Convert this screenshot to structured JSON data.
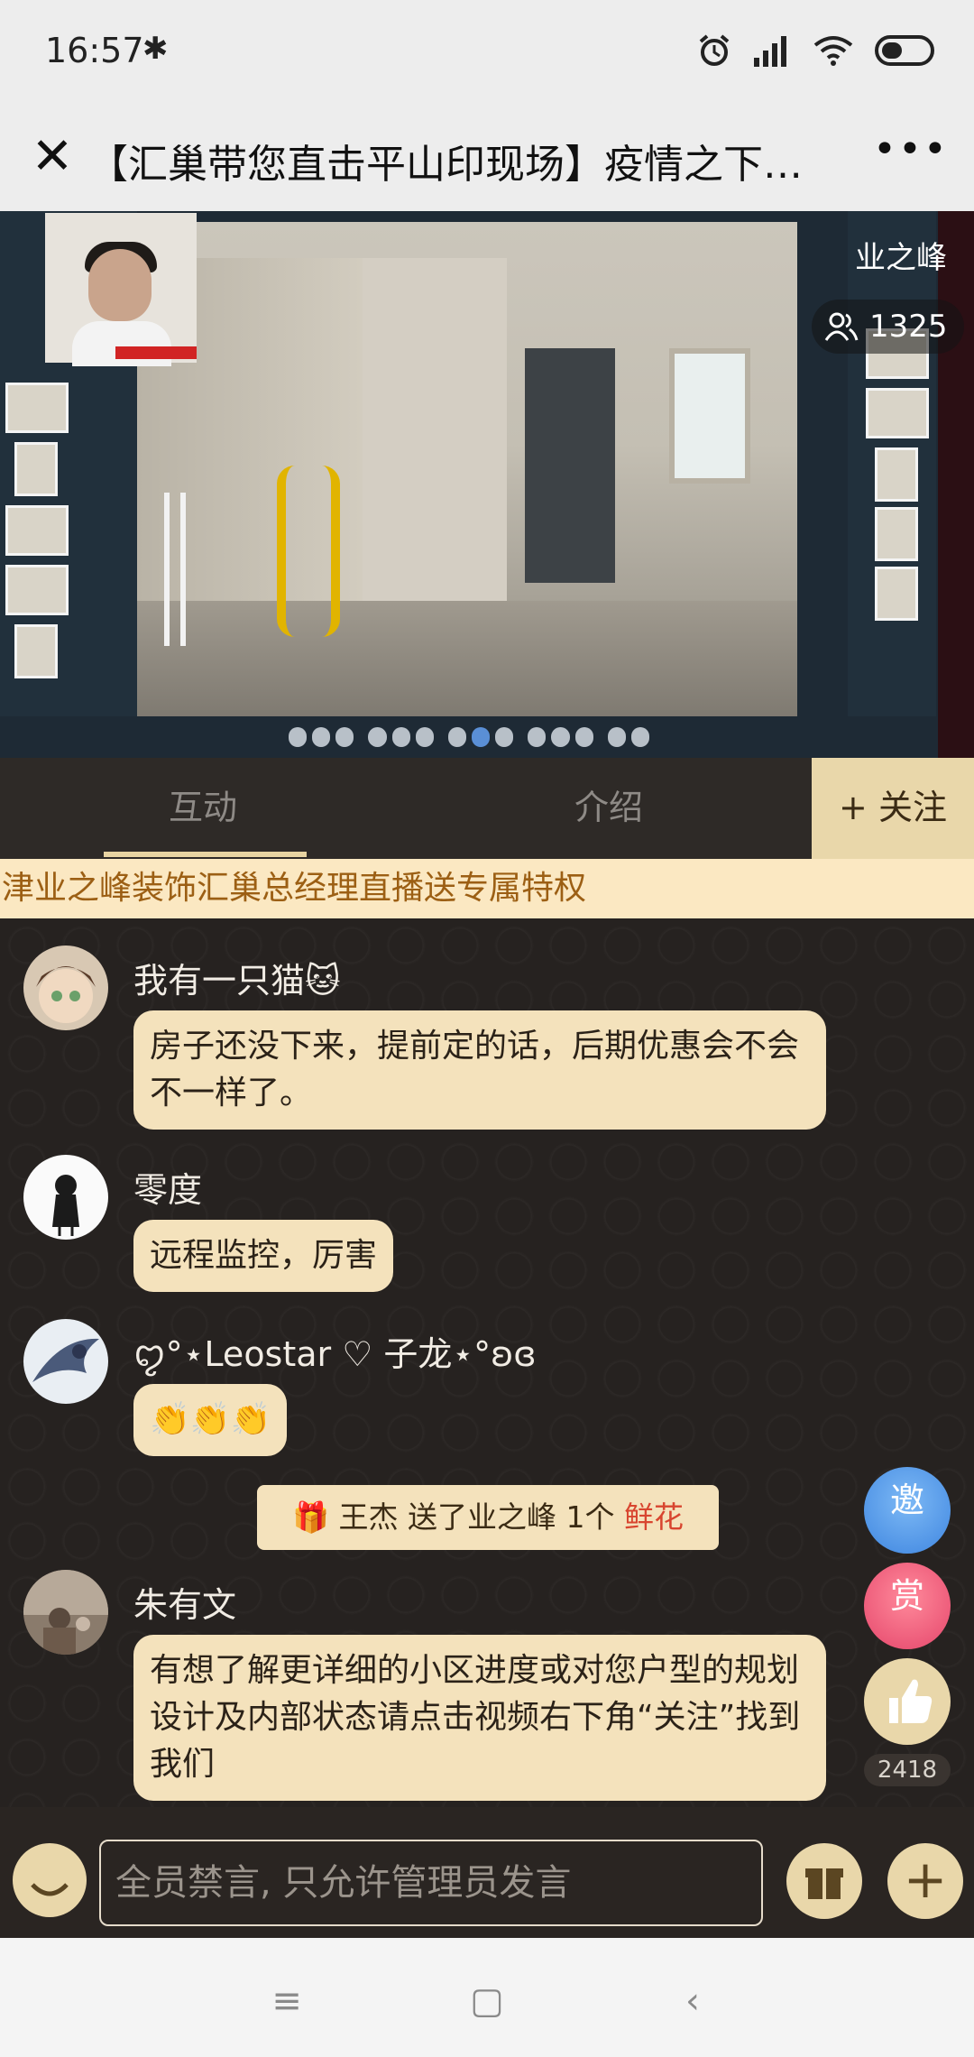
{
  "status_bar": {
    "time": "16:57"
  },
  "title_bar": {
    "title": "【汇巢带您直击平山印现场】疫情之下指..."
  },
  "video": {
    "host_name": "业之峰",
    "viewer_count": "1325"
  },
  "tabs": [
    {
      "label": "互动"
    },
    {
      "label": "介绍"
    }
  ],
  "follow_button": "+ 关注",
  "banner": {
    "text": "津业之峰装饰汇巢总经理直播送专属特权"
  },
  "messages": [
    {
      "name": "我有一只猫🐱",
      "text": "房子还没下来，提前定的话，后期优惠会不会不一样了。"
    },
    {
      "name": "零度",
      "text": "远程监控，厉害"
    },
    {
      "name": "ꨄ°⋆Leostar ♡ 子龙⋆°ʚɞ",
      "text": "👏👏👏"
    },
    {
      "name": "朱有文",
      "text": "有想了解更详细的小区进度或对您户型的规划设计及内部状态请点击视频右下角“关注”找到我们"
    }
  ],
  "gift_notice": {
    "user": "王杰",
    "action": "送了业之峰 1个",
    "gift": "鲜花"
  },
  "side_buttons": {
    "invite": "邀",
    "reward": "赏",
    "like_count": "2418"
  },
  "input": {
    "placeholder": "全员禁言, 只允许管理员发言"
  }
}
